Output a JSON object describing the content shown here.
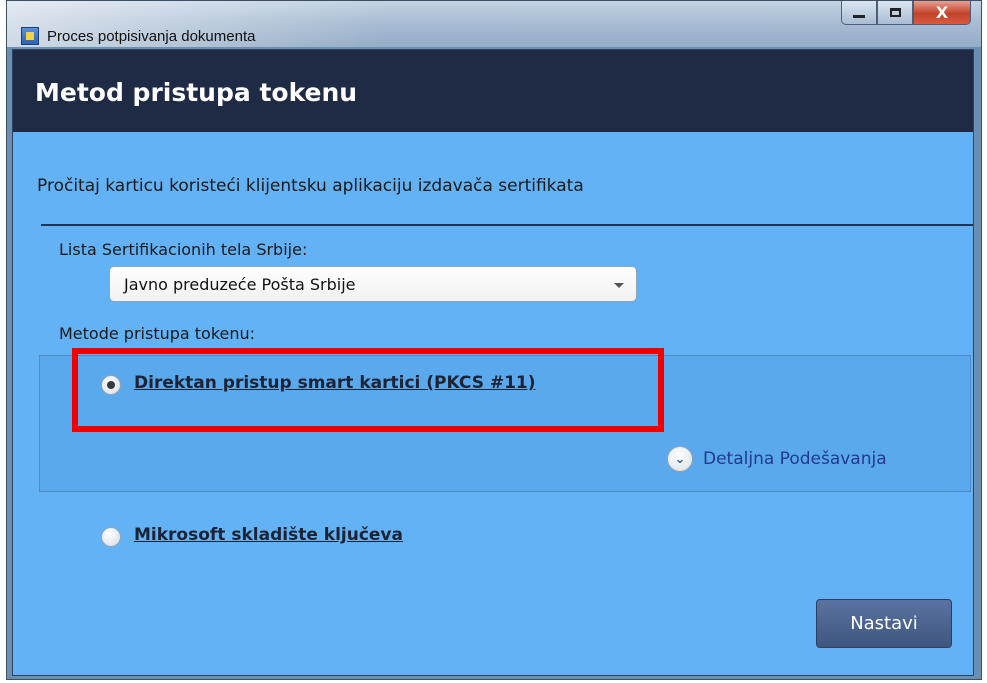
{
  "window": {
    "title": "Proces potpisivanja dokumenta",
    "icons": {
      "app": "app-icon",
      "minimize": "minimize-icon",
      "maximize": "maximize-icon",
      "close": "close-icon"
    },
    "close_glyph": "X"
  },
  "header": {
    "title": "Metod pristupa tokenu"
  },
  "subtitle": "Pročitaj karticu koristeći klijentsku aplikaciju izdavača sertifikata",
  "ca_list": {
    "label": "Lista Sertifikacionih tela Srbije:",
    "selected": "Javno preduzeće Pošta Srbije"
  },
  "methods": {
    "label": "Metode pristupa tokenu:",
    "options": [
      {
        "label": "Direktan pristup smart kartici (PKCS #11)",
        "selected": true
      },
      {
        "label": "Mikrosoft skladište ključeva",
        "selected": false
      }
    ],
    "details_label": "Detaljna Podešavanja",
    "details_icon": "chevron-down-icon"
  },
  "actions": {
    "next_label": "Nastavi"
  },
  "colors": {
    "highlight": "#ee0000",
    "header_bg": "#1f2a44",
    "client_bg": "#62b2f5",
    "button_bg": "#4a6390"
  }
}
